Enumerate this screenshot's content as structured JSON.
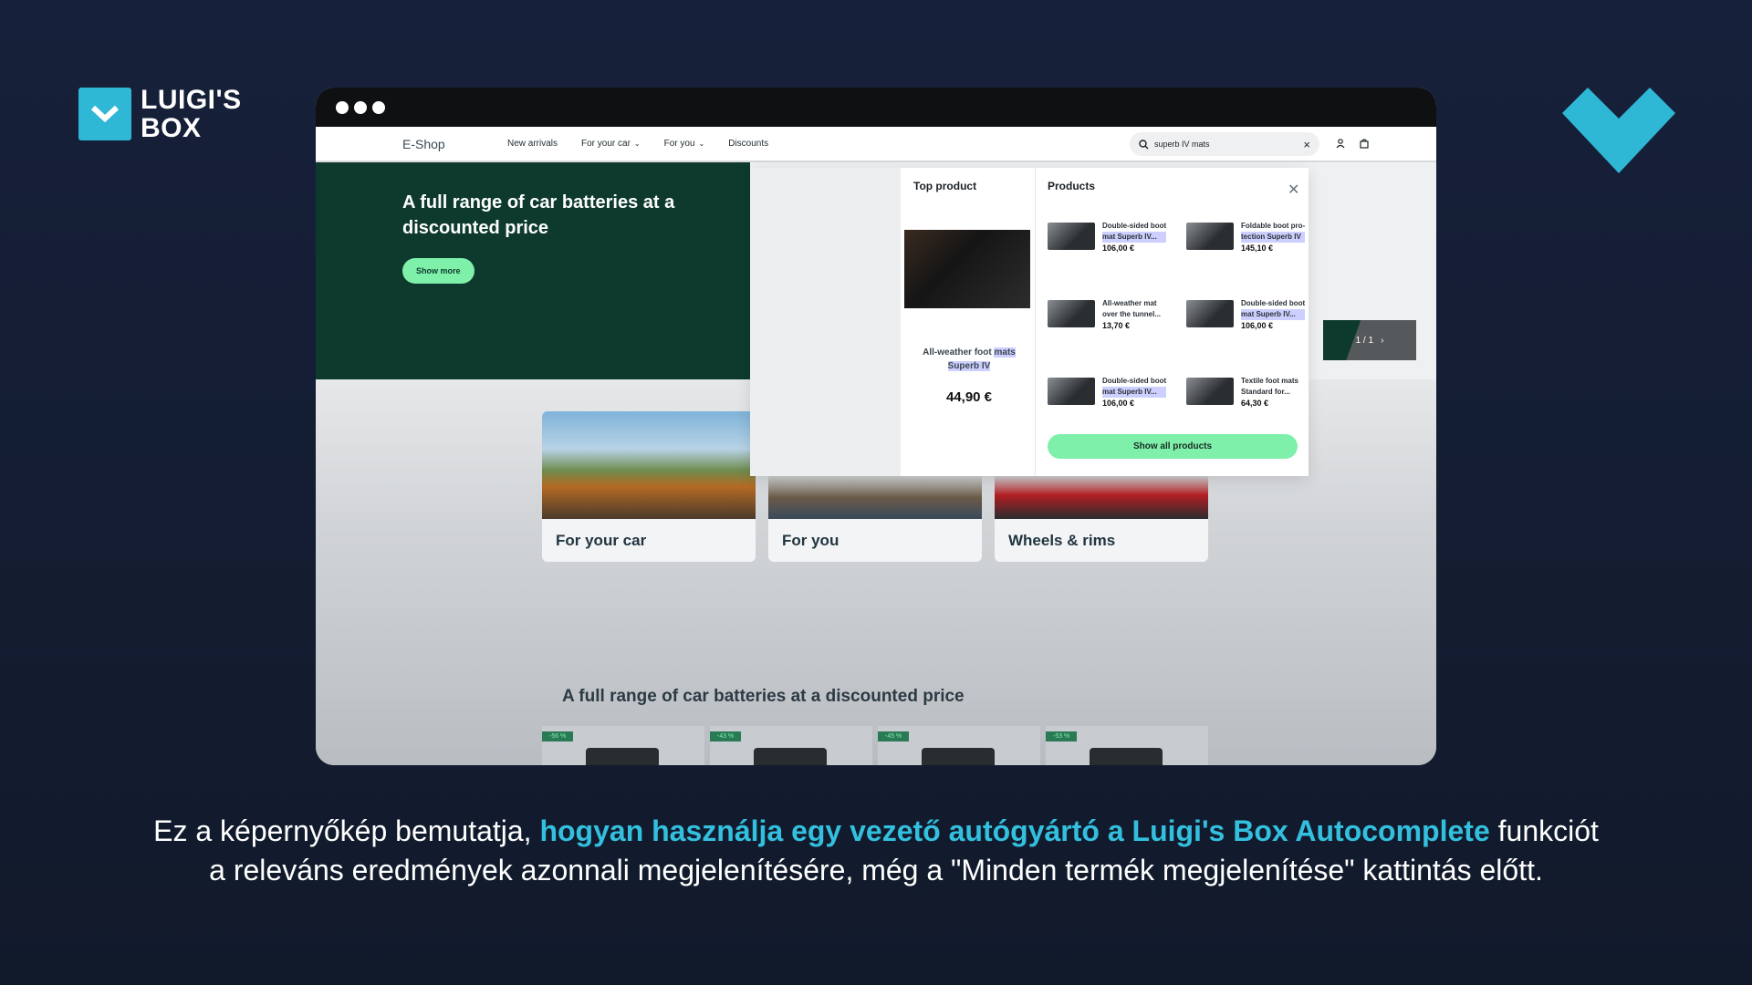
{
  "brand": {
    "name_line1": "LUIGI'S",
    "name_line2": "BOX",
    "accent_color": "#2fb7d6"
  },
  "shop": {
    "name": "E-Shop",
    "nav": [
      {
        "label": "New arrivals",
        "has_dropdown": false
      },
      {
        "label": "For your car",
        "has_dropdown": true
      },
      {
        "label": "For you",
        "has_dropdown": true
      },
      {
        "label": "Discounts",
        "has_dropdown": false
      }
    ],
    "search_value": "superb IV mats",
    "icons": [
      "user-icon",
      "bag-icon"
    ]
  },
  "hero": {
    "title": "A full range of car batteries at a discounted price",
    "button": "Show more",
    "slider_counter": "1 / 1"
  },
  "categories": [
    "For your car",
    "For you",
    "Wheels & rims"
  ],
  "section_title": "A full range of car batteries at a discounted price",
  "batteries": [
    "-56 %",
    "-43 %",
    "-45 %",
    "-53 %"
  ],
  "autocomplete": {
    "top_heading": "Top product",
    "top_product": {
      "name_plain": "All-weather foot",
      "name_hl1": "mats",
      "name_hl2": "Superb IV",
      "price": "44,90 €"
    },
    "products_heading": "Products",
    "products": [
      {
        "line1": "Double-sided boot",
        "line2_hl": "mat Superb IV...",
        "price": "106,00 €"
      },
      {
        "line1": "Foldable boot pro-",
        "line2_hl": "tection Superb IV",
        "price": "145,10 €"
      },
      {
        "line1": "All-weather mat",
        "line2_hl": "over the tunnel...",
        "price": "13,70 €"
      },
      {
        "line1": "Double-sided boot",
        "line2_hl": "mat Superb IV...",
        "price": "106,00 €"
      },
      {
        "line1": "Double-sided boot",
        "line2_hl": "mat Superb IV...",
        "price": "106,00 €"
      },
      {
        "line1": "Textile foot mats",
        "line2_hl": "Standard for...",
        "price": "64,30 €"
      }
    ],
    "show_all": "Show all products"
  },
  "caption": {
    "part1": "Ez a képernyőkép bemutatja, ",
    "accent": "hogyan használja egy vezető autógyártó a Luigi's Box Autocomplete",
    "part2": " funkciót a releváns eredmények azonnali megjelenítésére, még a \"Minden termék megjelenítése\" kattintás előtt."
  }
}
